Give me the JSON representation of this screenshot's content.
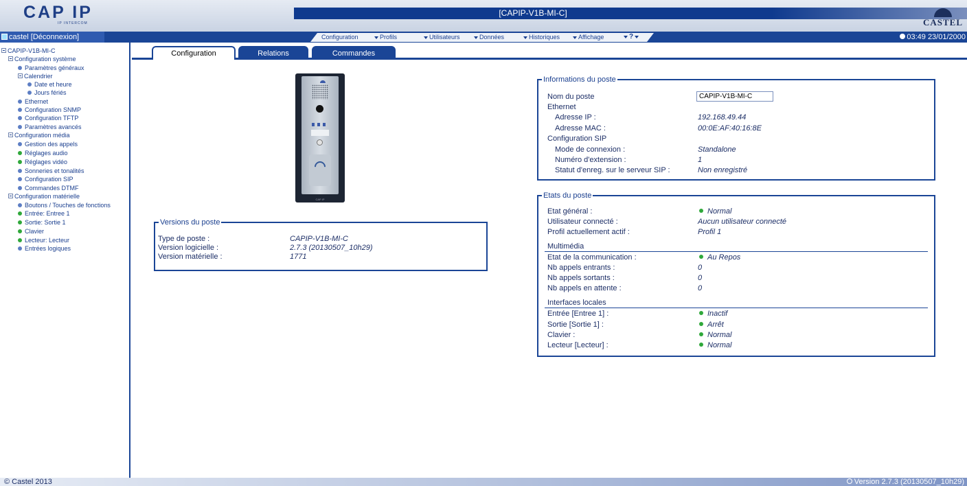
{
  "header": {
    "logo_text": "CAP IP",
    "logo_sub": "IP INTERCOM",
    "station_title": "[CAPIP-V1B-MI-C]",
    "brand": "CASTEL"
  },
  "menubar": {
    "user": "castel [Déconnexion]",
    "items": [
      "Configuration",
      "Profils",
      "Utilisateurs",
      "Données",
      "Historiques",
      "Affichage"
    ],
    "help": "?",
    "clock": "03:49 23/01/2000"
  },
  "sidebar": {
    "root": "CAPIP-V1B-MI-C",
    "items": [
      {
        "label": "Configuration système",
        "kind": "folder"
      },
      {
        "label": "Paramètres généraux",
        "kind": "blue"
      },
      {
        "label": "Calendrier",
        "kind": "folder"
      },
      {
        "label": "Date et heure",
        "kind": "blue"
      },
      {
        "label": "Jours fériés",
        "kind": "blue"
      },
      {
        "label": "Ethernet",
        "kind": "blue"
      },
      {
        "label": "Configuration SNMP",
        "kind": "blue"
      },
      {
        "label": "Configuration TFTP",
        "kind": "blue"
      },
      {
        "label": "Paramètres avancés",
        "kind": "blue"
      },
      {
        "label": "Configuration média",
        "kind": "folder"
      },
      {
        "label": "Gestion des appels",
        "kind": "blue"
      },
      {
        "label": "Réglages audio",
        "kind": "green"
      },
      {
        "label": "Réglages vidéo",
        "kind": "green"
      },
      {
        "label": "Sonneries et tonalités",
        "kind": "blue"
      },
      {
        "label": "Configuration SIP",
        "kind": "blue"
      },
      {
        "label": "Commandes DTMF",
        "kind": "blue"
      },
      {
        "label": "Configuration matérielle",
        "kind": "folder"
      },
      {
        "label": "Boutons / Touches de fonctions",
        "kind": "blue"
      },
      {
        "label": "Entrée: Entree 1",
        "kind": "green"
      },
      {
        "label": "Sortie: Sortie 1",
        "kind": "green"
      },
      {
        "label": "Clavier",
        "kind": "green"
      },
      {
        "label": "Lecteur: Lecteur",
        "kind": "green"
      },
      {
        "label": "Entrées logiques",
        "kind": "blue"
      }
    ]
  },
  "tabs": [
    {
      "label": "Configuration",
      "active": true
    },
    {
      "label": "Relations",
      "active": false
    },
    {
      "label": "Commandes",
      "active": false
    }
  ],
  "versions": {
    "title": "Versions du poste",
    "rows": [
      {
        "label": "Type de poste :",
        "value": "CAPIP-V1B-MI-C"
      },
      {
        "label": "Version logicielle :",
        "value": "2.7.3 (20130507_10h29)"
      },
      {
        "label": "Version matérielle :",
        "value": "1771"
      }
    ]
  },
  "device_image": {
    "brand": "CAP IP"
  },
  "info": {
    "title": "Informations du poste",
    "name_label": "Nom du poste",
    "name_value": "CAPIP-V1B-MI-C",
    "ethernet_label": "Ethernet",
    "ip_label": "Adresse IP :",
    "ip_value": "192.168.49.44",
    "mac_label": "Adresse MAC :",
    "mac_value": "00:0E:AF:40:16:8E",
    "sip_label": "Configuration SIP",
    "mode_label": "Mode de connexion :",
    "mode_value": "Standalone",
    "ext_label": "Numéro d'extension :",
    "ext_value": "1",
    "reg_label": "Statut d'enreg. sur le serveur SIP :",
    "reg_value": "Non enregistré"
  },
  "etats": {
    "title": "Etats du poste",
    "general_label": "Etat général :",
    "general_value": "Normal",
    "user_label": "Utilisateur connecté :",
    "user_value": "Aucun utilisateur connecté",
    "profile_label": "Profil actuellement actif :",
    "profile_value": "Profil 1",
    "multimedia_label": "Multimédia",
    "comm_label": "Etat de la communication :",
    "comm_value": "Au Repos",
    "in_label": "Nb appels entrants :",
    "in_value": "0",
    "out_label": "Nb appels sortants :",
    "out_value": "0",
    "wait_label": "Nb appels en attente :",
    "wait_value": "0",
    "local_label": "Interfaces locales",
    "entree_label": "Entrée [Entree 1] :",
    "entree_value": "Inactif",
    "sortie_label": "Sortie [Sortie 1] :",
    "sortie_value": "Arrêt",
    "clavier_label": "Clavier :",
    "clavier_value": "Normal",
    "lecteur_label": "Lecteur [Lecteur] :",
    "lecteur_value": "Normal"
  },
  "footer": {
    "copyright": "© Castel 2013",
    "version": "Version 2.7.3 (20130507_10h29)"
  }
}
